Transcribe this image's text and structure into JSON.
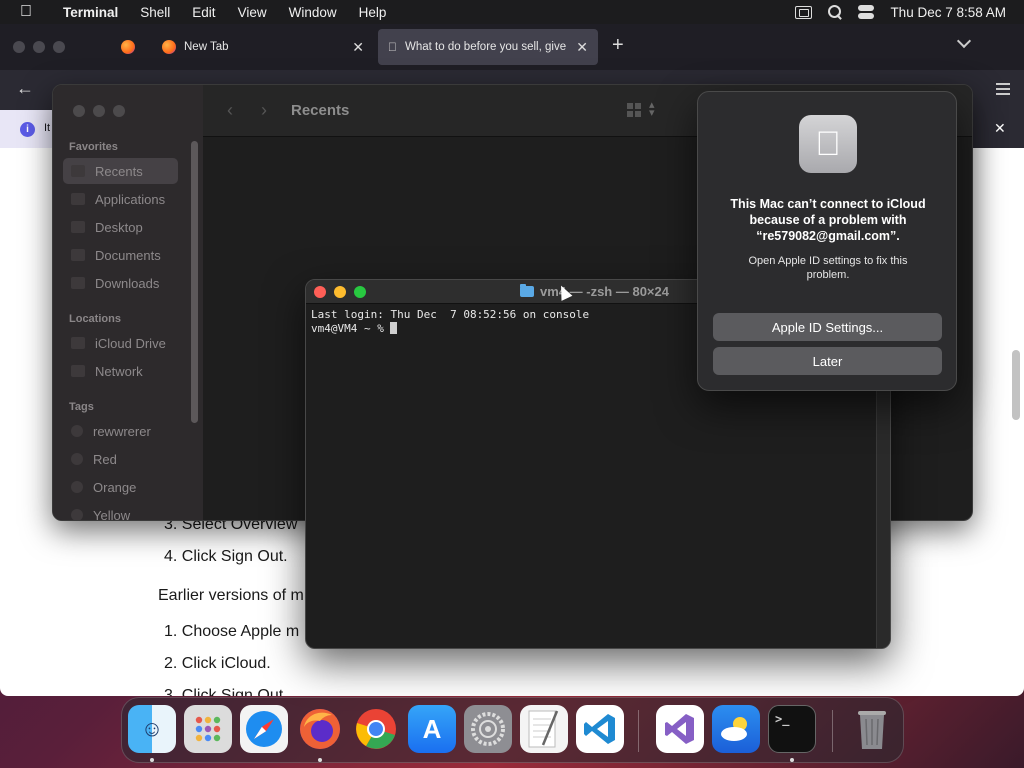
{
  "menubar": {
    "app_name": "Terminal",
    "menus": [
      "Shell",
      "Edit",
      "View",
      "Window",
      "Help"
    ],
    "clock": "Thu Dec 7  8:58 AM"
  },
  "browser": {
    "tabs": [
      {
        "label": ""
      },
      {
        "label": "New Tab"
      },
      {
        "label": "What to do before you sell, give"
      }
    ],
    "infobar_text": "It",
    "content_lines": [
      "3. Select Overview",
      "4. Click Sign Out.",
      "Earlier versions of m",
      "1. Choose Apple m",
      "2. Click iCloud.",
      "3. Click Sign Out"
    ]
  },
  "finder": {
    "title": "Recents",
    "sidebar": {
      "favorites_header": "Favorites",
      "favorites": [
        "Recents",
        "Applications",
        "Desktop",
        "Documents",
        "Downloads"
      ],
      "locations_header": "Locations",
      "locations": [
        "iCloud Drive",
        "Network"
      ],
      "tags_header": "Tags",
      "tags": [
        "rewwrerer",
        "Red",
        "Orange",
        "Yellow"
      ]
    }
  },
  "terminal": {
    "title": "vm4 — -zsh — 80×24",
    "lines": [
      "Last login: Thu Dec  7 08:52:56 on console",
      "vm4@VM4 ~ % "
    ]
  },
  "alert": {
    "heading": "This Mac can’t connect to iCloud because of a problem with “re579082@gmail.com”.",
    "body": "Open Apple ID settings to fix this problem.",
    "primary_button": "Apple ID Settings...",
    "secondary_button": "Later"
  },
  "dock": {
    "apps": [
      "Finder",
      "Launchpad",
      "Safari",
      "Firefox",
      "Google Chrome",
      "App Store",
      "System Settings",
      "TextEdit",
      "Visual Studio Code",
      "Visual Studio",
      "Weather",
      "Terminal",
      "Trash"
    ]
  }
}
